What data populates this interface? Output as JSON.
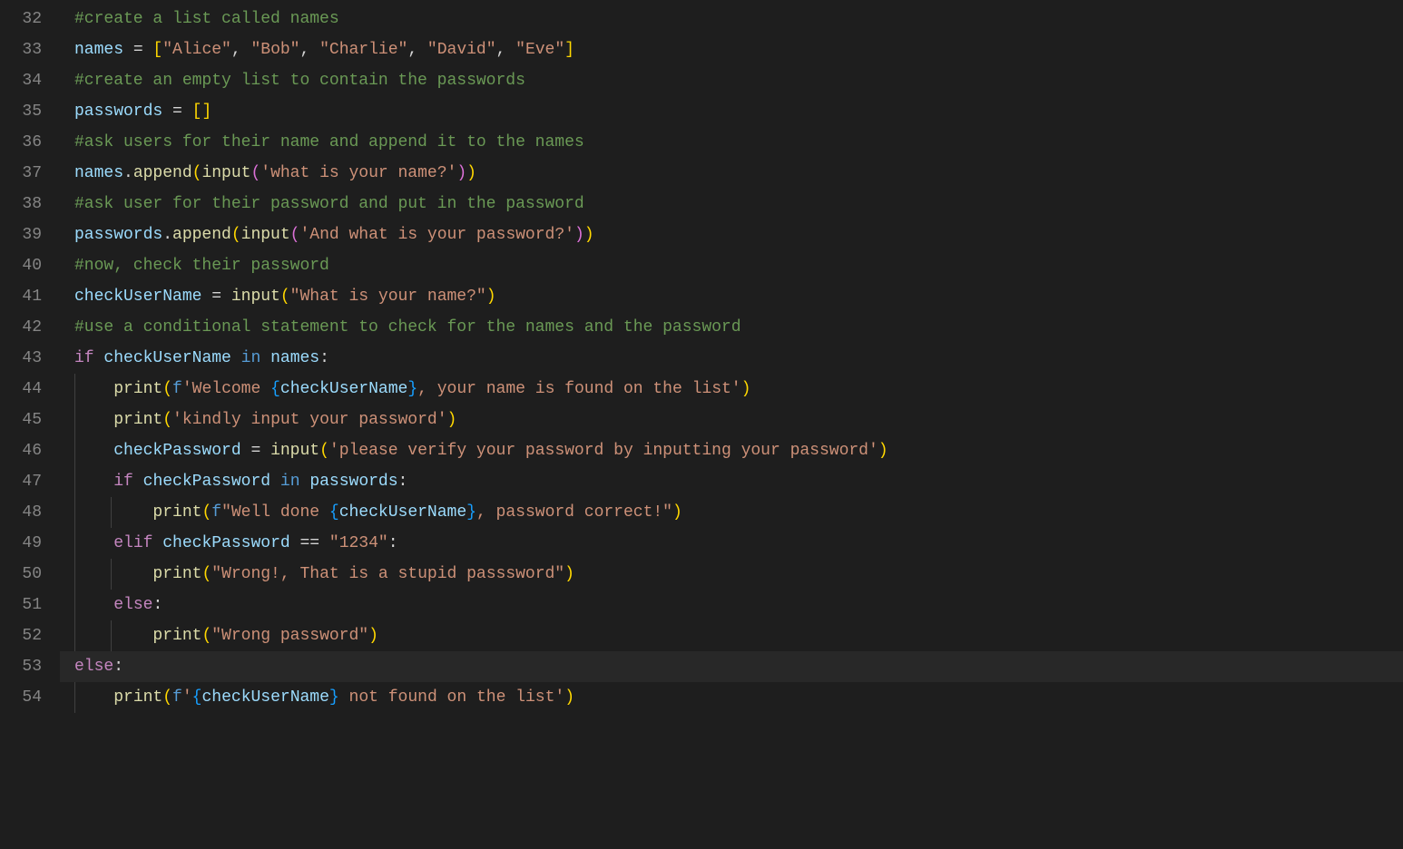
{
  "editor": {
    "first_line_number": 32,
    "highlighted_line_index": 21,
    "line_numbers": [
      "32",
      "33",
      "34",
      "35",
      "36",
      "37",
      "38",
      "39",
      "40",
      "41",
      "42",
      "43",
      "44",
      "45",
      "46",
      "47",
      "48",
      "49",
      "50",
      "51",
      "52",
      "53",
      "54"
    ],
    "lines": [
      {
        "indent": 0,
        "tokens": [
          {
            "c": "comment",
            "t": "#create a list called names"
          }
        ]
      },
      {
        "indent": 0,
        "tokens": [
          {
            "c": "var",
            "t": "names"
          },
          {
            "c": "op",
            "t": " = "
          },
          {
            "c": "brace",
            "t": "["
          },
          {
            "c": "string",
            "t": "\"Alice\""
          },
          {
            "c": "punct",
            "t": ", "
          },
          {
            "c": "string",
            "t": "\"Bob\""
          },
          {
            "c": "punct",
            "t": ", "
          },
          {
            "c": "string",
            "t": "\"Charlie\""
          },
          {
            "c": "punct",
            "t": ", "
          },
          {
            "c": "string",
            "t": "\"David\""
          },
          {
            "c": "punct",
            "t": ", "
          },
          {
            "c": "string",
            "t": "\"Eve\""
          },
          {
            "c": "brace",
            "t": "]"
          }
        ]
      },
      {
        "indent": 0,
        "tokens": [
          {
            "c": "comment",
            "t": "#create an empty list to contain the passwords"
          }
        ]
      },
      {
        "indent": 0,
        "tokens": [
          {
            "c": "var",
            "t": "passwords"
          },
          {
            "c": "op",
            "t": " = "
          },
          {
            "c": "brace",
            "t": "["
          },
          {
            "c": "brace",
            "t": "]"
          }
        ]
      },
      {
        "indent": 0,
        "tokens": [
          {
            "c": "comment",
            "t": "#ask users for their name and append it to the names"
          }
        ]
      },
      {
        "indent": 0,
        "tokens": [
          {
            "c": "var",
            "t": "names"
          },
          {
            "c": "punct",
            "t": "."
          },
          {
            "c": "func",
            "t": "append"
          },
          {
            "c": "brace",
            "t": "("
          },
          {
            "c": "func",
            "t": "input"
          },
          {
            "c": "brace2",
            "t": "("
          },
          {
            "c": "string",
            "t": "'what is your name?'"
          },
          {
            "c": "brace2",
            "t": ")"
          },
          {
            "c": "brace",
            "t": ")"
          }
        ]
      },
      {
        "indent": 0,
        "tokens": [
          {
            "c": "comment",
            "t": "#ask user for their password and put in the password"
          }
        ]
      },
      {
        "indent": 0,
        "tokens": [
          {
            "c": "var",
            "t": "passwords"
          },
          {
            "c": "punct",
            "t": "."
          },
          {
            "c": "func",
            "t": "append"
          },
          {
            "c": "brace",
            "t": "("
          },
          {
            "c": "func",
            "t": "input"
          },
          {
            "c": "brace2",
            "t": "("
          },
          {
            "c": "string",
            "t": "'And what is your password?'"
          },
          {
            "c": "brace2",
            "t": ")"
          },
          {
            "c": "brace",
            "t": ")"
          }
        ]
      },
      {
        "indent": 0,
        "tokens": [
          {
            "c": "comment",
            "t": "#now, check their password"
          }
        ]
      },
      {
        "indent": 0,
        "tokens": [
          {
            "c": "var",
            "t": "checkUserName"
          },
          {
            "c": "op",
            "t": " = "
          },
          {
            "c": "func",
            "t": "input"
          },
          {
            "c": "brace",
            "t": "("
          },
          {
            "c": "string",
            "t": "\"What is your name?\""
          },
          {
            "c": "brace",
            "t": ")"
          }
        ]
      },
      {
        "indent": 0,
        "tokens": [
          {
            "c": "comment",
            "t": "#use a conditional statement to check for the names and the password"
          }
        ]
      },
      {
        "indent": 0,
        "tokens": [
          {
            "c": "keyword",
            "t": "if"
          },
          {
            "c": "punct",
            "t": " "
          },
          {
            "c": "var",
            "t": "checkUserName"
          },
          {
            "c": "punct",
            "t": " "
          },
          {
            "c": "keyword2",
            "t": "in"
          },
          {
            "c": "punct",
            "t": " "
          },
          {
            "c": "var",
            "t": "names"
          },
          {
            "c": "punct",
            "t": ":"
          }
        ]
      },
      {
        "indent": 1,
        "tokens": [
          {
            "c": "func",
            "t": "print"
          },
          {
            "c": "brace",
            "t": "("
          },
          {
            "c": "keyword2",
            "t": "f"
          },
          {
            "c": "string",
            "t": "'Welcome "
          },
          {
            "c": "brace3",
            "t": "{"
          },
          {
            "c": "var",
            "t": "checkUserName"
          },
          {
            "c": "brace3",
            "t": "}"
          },
          {
            "c": "string",
            "t": ", your name is found on the list'"
          },
          {
            "c": "brace",
            "t": ")"
          }
        ]
      },
      {
        "indent": 1,
        "tokens": [
          {
            "c": "func",
            "t": "print"
          },
          {
            "c": "brace",
            "t": "("
          },
          {
            "c": "string",
            "t": "'kindly input your password'"
          },
          {
            "c": "brace",
            "t": ")"
          }
        ]
      },
      {
        "indent": 1,
        "tokens": [
          {
            "c": "var",
            "t": "checkPassword"
          },
          {
            "c": "op",
            "t": " = "
          },
          {
            "c": "func",
            "t": "input"
          },
          {
            "c": "brace",
            "t": "("
          },
          {
            "c": "string",
            "t": "'please verify your password by inputting your password'"
          },
          {
            "c": "brace",
            "t": ")"
          }
        ]
      },
      {
        "indent": 1,
        "tokens": [
          {
            "c": "keyword",
            "t": "if"
          },
          {
            "c": "punct",
            "t": " "
          },
          {
            "c": "var",
            "t": "checkPassword"
          },
          {
            "c": "punct",
            "t": " "
          },
          {
            "c": "keyword2",
            "t": "in"
          },
          {
            "c": "punct",
            "t": " "
          },
          {
            "c": "var",
            "t": "passwords"
          },
          {
            "c": "punct",
            "t": ":"
          }
        ]
      },
      {
        "indent": 2,
        "tokens": [
          {
            "c": "func",
            "t": "print"
          },
          {
            "c": "brace",
            "t": "("
          },
          {
            "c": "keyword2",
            "t": "f"
          },
          {
            "c": "string",
            "t": "\"Well done "
          },
          {
            "c": "brace3",
            "t": "{"
          },
          {
            "c": "var",
            "t": "checkUserName"
          },
          {
            "c": "brace3",
            "t": "}"
          },
          {
            "c": "string",
            "t": ", password correct!\""
          },
          {
            "c": "brace",
            "t": ")"
          }
        ]
      },
      {
        "indent": 1,
        "tokens": [
          {
            "c": "keyword",
            "t": "elif"
          },
          {
            "c": "punct",
            "t": " "
          },
          {
            "c": "var",
            "t": "checkPassword"
          },
          {
            "c": "op",
            "t": " == "
          },
          {
            "c": "string",
            "t": "\"1234\""
          },
          {
            "c": "punct",
            "t": ":"
          }
        ]
      },
      {
        "indent": 2,
        "tokens": [
          {
            "c": "func",
            "t": "print"
          },
          {
            "c": "brace",
            "t": "("
          },
          {
            "c": "string",
            "t": "\"Wrong!, That is a stupid passsword\""
          },
          {
            "c": "brace",
            "t": ")"
          }
        ]
      },
      {
        "indent": 1,
        "tokens": [
          {
            "c": "keyword",
            "t": "else"
          },
          {
            "c": "punct",
            "t": ":"
          }
        ]
      },
      {
        "indent": 2,
        "tokens": [
          {
            "c": "func",
            "t": "print"
          },
          {
            "c": "brace",
            "t": "("
          },
          {
            "c": "string",
            "t": "\"Wrong password\""
          },
          {
            "c": "brace",
            "t": ")"
          }
        ]
      },
      {
        "indent": 0,
        "tokens": [
          {
            "c": "keyword",
            "t": "else"
          },
          {
            "c": "punct",
            "t": ":"
          }
        ]
      },
      {
        "indent": 1,
        "tokens": [
          {
            "c": "func",
            "t": "print"
          },
          {
            "c": "brace",
            "t": "("
          },
          {
            "c": "keyword2",
            "t": "f"
          },
          {
            "c": "string",
            "t": "'"
          },
          {
            "c": "brace3",
            "t": "{"
          },
          {
            "c": "var",
            "t": "checkUserName"
          },
          {
            "c": "brace3",
            "t": "}"
          },
          {
            "c": "string",
            "t": " not found on the list'"
          },
          {
            "c": "brace",
            "t": ")"
          }
        ]
      }
    ]
  }
}
